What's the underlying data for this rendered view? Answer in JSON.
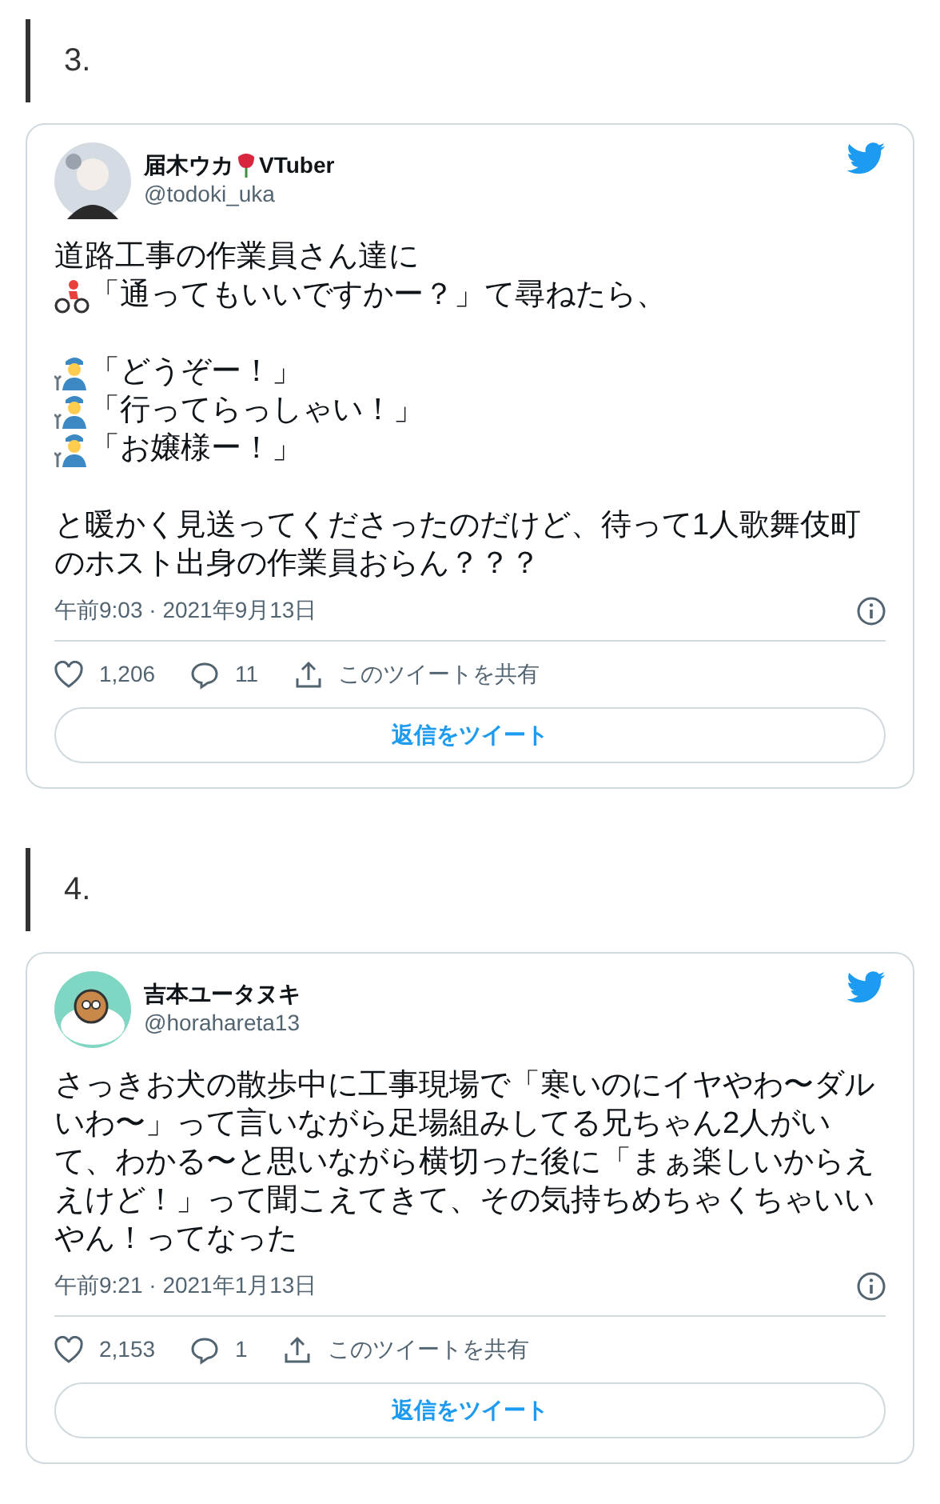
{
  "sections": [
    {
      "heading": "3.",
      "tweet": {
        "name_parts": [
          {
            "kind": "text",
            "text": "届木ウカ"
          },
          {
            "kind": "rose"
          },
          {
            "kind": "text",
            "text": "VTuber"
          }
        ],
        "handle": "@todoki_uka",
        "paragraphs": [
          [
            {
              "kind": "plain",
              "text": "道路工事の作業員さん達に"
            },
            {
              "kind": "cyclist",
              "text": "「通ってもいいですかー？」て尋ねたら、"
            }
          ],
          [
            {
              "kind": "mechanic",
              "text": "「どうぞー！」"
            },
            {
              "kind": "mechanic",
              "text": "「行ってらっしゃい！」"
            },
            {
              "kind": "mechanic",
              "text": "「お嬢様ー！」"
            }
          ],
          [
            {
              "kind": "plain",
              "text": "と暖かく見送ってくださったのだけど、待って1人歌舞伎町のホスト出身の作業員おらん？？？"
            }
          ]
        ],
        "timestamp": "午前9:03 · 2021年9月13日",
        "likes": "1,206",
        "replies": "11",
        "share": "このツイートを共有",
        "reply_button": "返信をツイート"
      }
    },
    {
      "heading": "4.",
      "tweet": {
        "name_parts": [
          {
            "kind": "text",
            "text": "吉本ユータヌキ"
          }
        ],
        "handle": "@horahareta13",
        "paragraphs": [
          [
            {
              "kind": "plain",
              "text": "さっきお犬の散歩中に工事現場で「寒いのにイヤやわ〜ダルいわ〜」って言いながら足場組みしてる兄ちゃん2人がいて、わかる〜と思いながら横切った後に「まぁ楽しいからええけど！」って聞こえてきて、その気持ちめちゃくちゃいいやん！ってなった"
            }
          ]
        ],
        "timestamp": "午前9:21 · 2021年1月13日",
        "likes": "2,153",
        "replies": "1",
        "share": "このツイートを共有",
        "reply_button": "返信をツイート"
      }
    }
  ]
}
